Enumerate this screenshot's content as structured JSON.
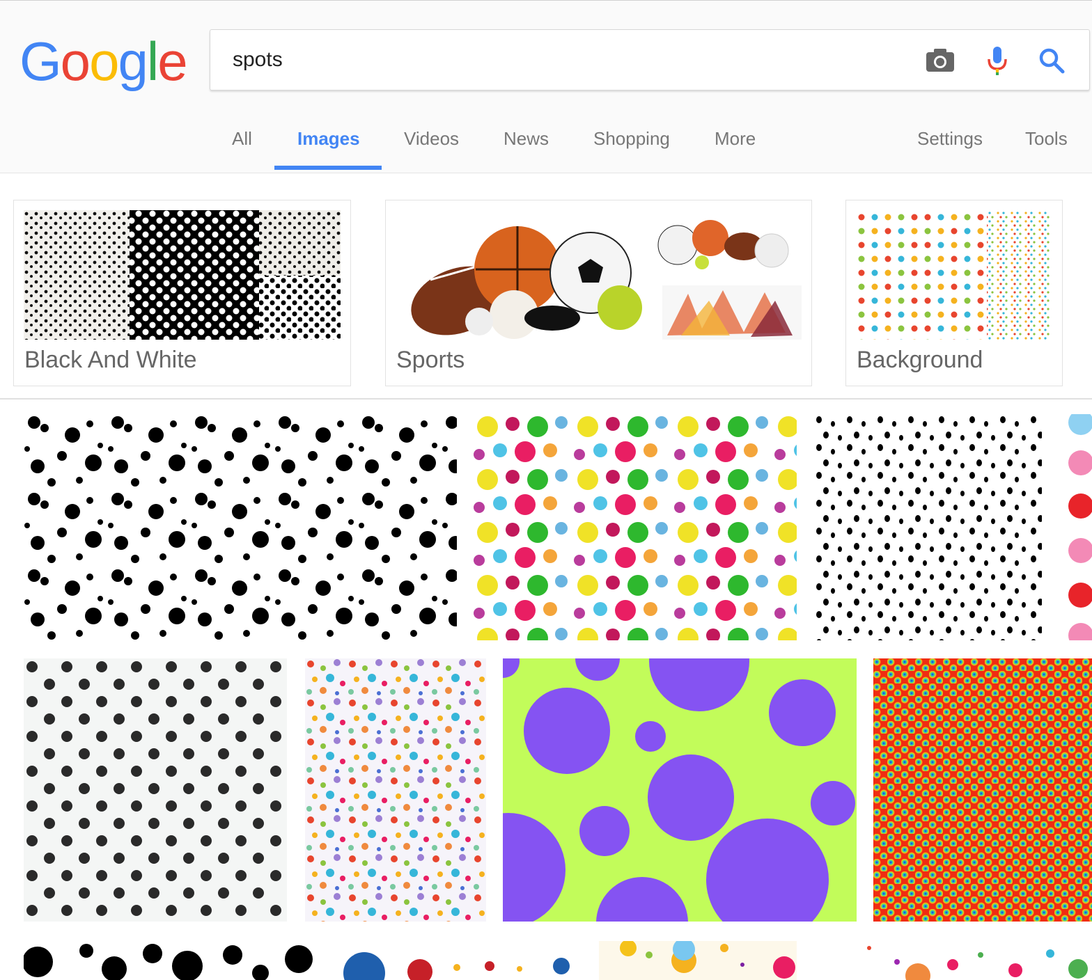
{
  "logo": {
    "letters": [
      "G",
      "o",
      "o",
      "g",
      "l",
      "e"
    ],
    "colors": [
      "#4285F4",
      "#EA4335",
      "#FBBC05",
      "#4285F4",
      "#34A853",
      "#EA4335"
    ]
  },
  "search": {
    "query": "spots"
  },
  "icons": {
    "camera": "camera-icon",
    "mic": "microphone-icon",
    "search": "search-icon"
  },
  "tabs": [
    {
      "label": "All"
    },
    {
      "label": "Images",
      "active": true
    },
    {
      "label": "Videos"
    },
    {
      "label": "News"
    },
    {
      "label": "Shopping"
    },
    {
      "label": "More"
    },
    {
      "label": "Settings"
    },
    {
      "label": "Tools"
    }
  ],
  "categories": [
    {
      "label": "Black And White"
    },
    {
      "label": "Sports"
    },
    {
      "label": "Background"
    }
  ],
  "colors": {
    "accent": "#4285F4",
    "tab_text": "#777777",
    "label_text": "#666666"
  }
}
